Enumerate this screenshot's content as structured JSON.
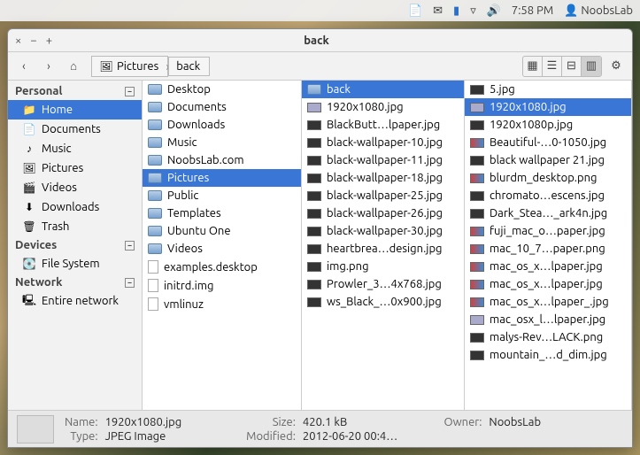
{
  "panel": {
    "time": "7:58 PM",
    "user": "NoobsLab"
  },
  "window": {
    "title": "back",
    "breadcrumb": [
      "Pictures",
      "back"
    ]
  },
  "sidebar": {
    "sections": [
      {
        "title": "Personal",
        "items": [
          {
            "label": "Home",
            "icon": "folder",
            "selected": true
          },
          {
            "label": "Documents",
            "icon": "doc"
          },
          {
            "label": "Music",
            "icon": "music"
          },
          {
            "label": "Pictures",
            "icon": "pic"
          },
          {
            "label": "Videos",
            "icon": "video"
          },
          {
            "label": "Downloads",
            "icon": "down"
          },
          {
            "label": "Trash",
            "icon": "trash"
          }
        ]
      },
      {
        "title": "Devices",
        "items": [
          {
            "label": "File System",
            "icon": "disk"
          }
        ]
      },
      {
        "title": "Network",
        "items": [
          {
            "label": "Entire network",
            "icon": "net"
          }
        ]
      }
    ]
  },
  "columns": [
    [
      {
        "label": "Desktop",
        "type": "folder"
      },
      {
        "label": "Documents",
        "type": "folder"
      },
      {
        "label": "Downloads",
        "type": "folder"
      },
      {
        "label": "Music",
        "type": "folder"
      },
      {
        "label": "NoobsLab.com",
        "type": "folder"
      },
      {
        "label": "Pictures",
        "type": "folder",
        "selected": true
      },
      {
        "label": "Public",
        "type": "folder"
      },
      {
        "label": "Templates",
        "type": "folder"
      },
      {
        "label": "Ubuntu One",
        "type": "folder"
      },
      {
        "label": "Videos",
        "type": "folder"
      },
      {
        "label": "examples.desktop",
        "type": "file"
      },
      {
        "label": "initrd.img",
        "type": "file"
      },
      {
        "label": "vmlinuz",
        "type": "file"
      }
    ],
    [
      {
        "label": "back",
        "type": "folder",
        "selected": true
      },
      {
        "label": "1920x1080.jpg",
        "type": "img-light"
      },
      {
        "label": "BlackButt…lpaper.jpg",
        "type": "img"
      },
      {
        "label": "black-wallpaper-10.jpg",
        "type": "img"
      },
      {
        "label": "black-wallpaper-11.jpg",
        "type": "img"
      },
      {
        "label": "black-wallpaper-18.jpg",
        "type": "img"
      },
      {
        "label": "black-wallpaper-25.jpg",
        "type": "img"
      },
      {
        "label": "black-wallpaper-26.jpg",
        "type": "img"
      },
      {
        "label": "black-wallpaper-30.jpg",
        "type": "img"
      },
      {
        "label": "heartbrea…design.jpg",
        "type": "img"
      },
      {
        "label": "img.png",
        "type": "img"
      },
      {
        "label": "Prowler_3…4x768.jpg",
        "type": "img"
      },
      {
        "label": "ws_Black_…0x900.jpg",
        "type": "img"
      }
    ],
    [
      {
        "label": "5.jpg",
        "type": "img"
      },
      {
        "label": "1920x1080.jpg",
        "type": "img-light",
        "selected": true
      },
      {
        "label": "1920x1080p.jpg",
        "type": "img"
      },
      {
        "label": "Beautiful-…0-1050.jpg",
        "type": "img-color"
      },
      {
        "label": "black wallpaper 21.jpg",
        "type": "img"
      },
      {
        "label": "blurdm_desktop.png",
        "type": "img-color"
      },
      {
        "label": "chromato…escens.jpg",
        "type": "img"
      },
      {
        "label": "Dark_Stea…_ark4n.jpg",
        "type": "img"
      },
      {
        "label": "fuji_mac_o…paper.jpg",
        "type": "img-color"
      },
      {
        "label": "mac_10_7…paper.png",
        "type": "img-color"
      },
      {
        "label": "mac_os_x…lpaper.jpg",
        "type": "img-color"
      },
      {
        "label": "mac_os_x…lpaper.jpg",
        "type": "img-color"
      },
      {
        "label": "mac_os_x…lpaper_.jpg",
        "type": "img-color"
      },
      {
        "label": "mac_osx_l…lpaper.jpg",
        "type": "img-light"
      },
      {
        "label": "malys-Rev…LACK.png",
        "type": "img"
      },
      {
        "label": "mountain_…d_dim.jpg",
        "type": "img"
      }
    ]
  ],
  "status": {
    "name_label": "Name:",
    "name": "1920x1080.jpg",
    "type_label": "Type:",
    "type": "JPEG Image",
    "size_label": "Size:",
    "size": "420.1 kB",
    "modified_label": "Modified:",
    "modified": "2012-06-20 00:4…",
    "owner_label": "Owner:",
    "owner": "NoobsLab"
  }
}
